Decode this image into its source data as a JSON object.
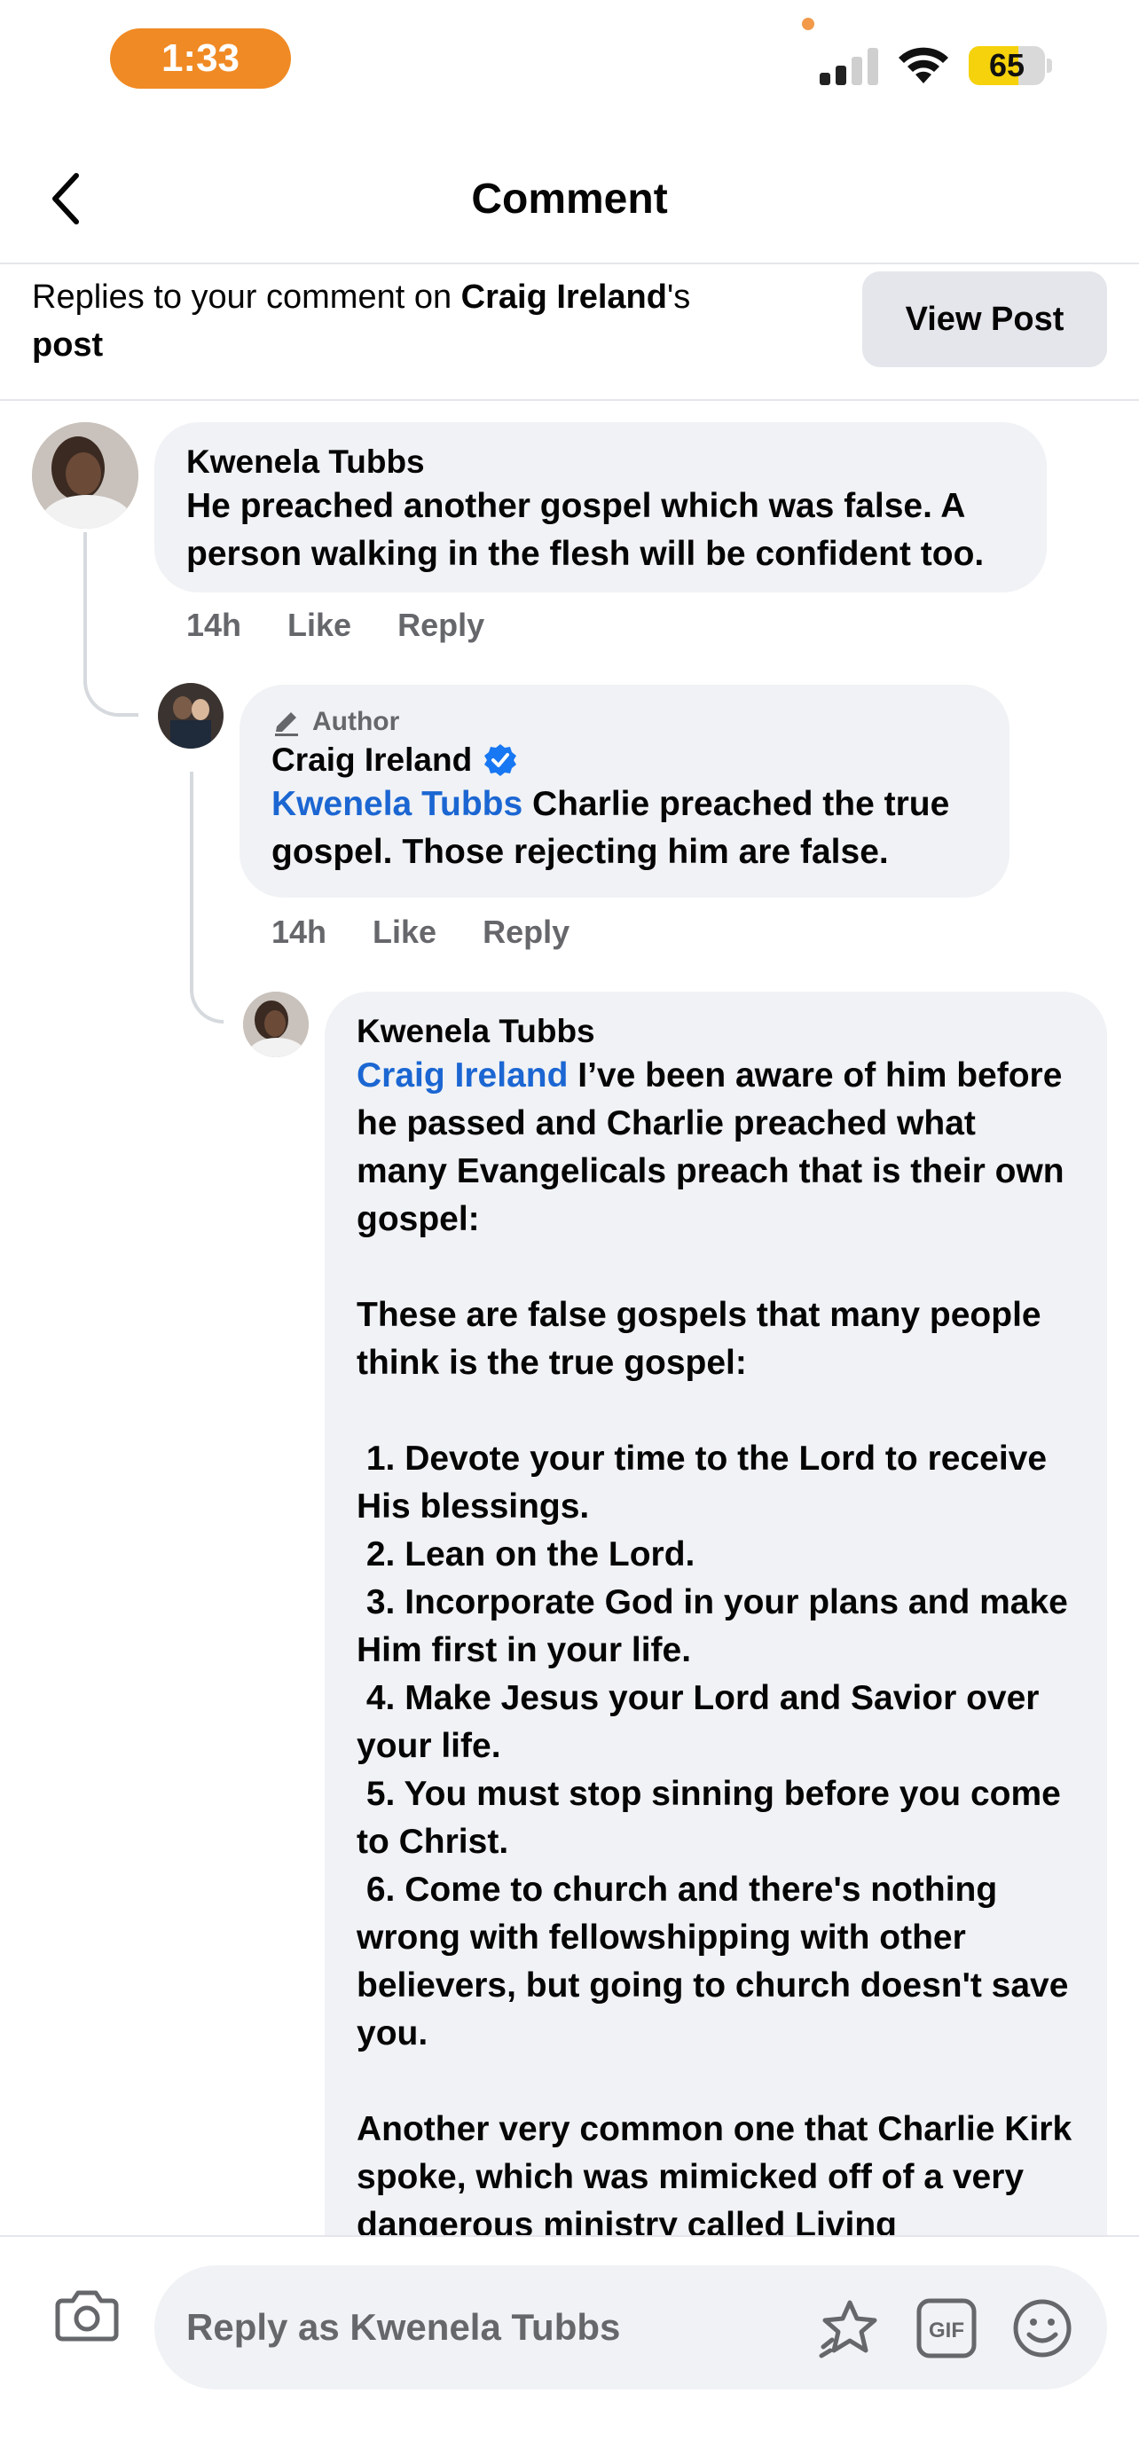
{
  "status_bar": {
    "time": "1:33",
    "battery_percent": "65",
    "battery_level": 0.65
  },
  "header": {
    "title": "Comment",
    "back_icon": "chevron-left-icon"
  },
  "replies_bar": {
    "prefix": "Replies to your comment on ",
    "post_owner": "Craig Ireland",
    "possessive": "'s",
    "post_word": "post",
    "view_post_label": "View Post"
  },
  "comments": [
    {
      "author": "Kwenela Tubbs",
      "text": "He preached another gospel which was false. A person walking in the flesh will be confident too.",
      "time": "14h",
      "like_label": "Like",
      "reply_label": "Reply"
    },
    {
      "badge": "Author",
      "author": "Craig Ireland",
      "verified": true,
      "mention": "Kwenela Tubbs",
      "text": " Charlie preached the true gospel. Those rejecting him are false.",
      "time": "14h",
      "like_label": "Like",
      "reply_label": "Reply"
    },
    {
      "author": "Kwenela Tubbs",
      "mention": "Craig Ireland",
      "text": " I’ve been aware of him before he passed and Charlie preached what many Evangelicals preach that is their own gospel:\n\nThese are false gospels that many people think is the true gospel:\n\n 1. Devote your time to the Lord to receive His blessings.\n 2. Lean on the Lord.\n 3. Incorporate God in your plans and make Him first in your life.\n 4. Make Jesus your Lord and Savior over your life.\n 5. You must stop sinning before you come to Christ.\n 6. Come to church and there's nothing wrong with fellowshipping with other believers, but going to church doesn't save you.\n\nAnother very common one that Charlie Kirk spoke, which was mimicked off of a very dangerous ministry called Living"
    }
  ],
  "composer": {
    "placeholder": "Reply as Kwenela Tubbs"
  },
  "colors": {
    "accent_orange": "#f08a24",
    "mention_blue": "#1b66d2",
    "bubble_gray": "#f0f2f5",
    "verified_blue": "#1877f2"
  }
}
